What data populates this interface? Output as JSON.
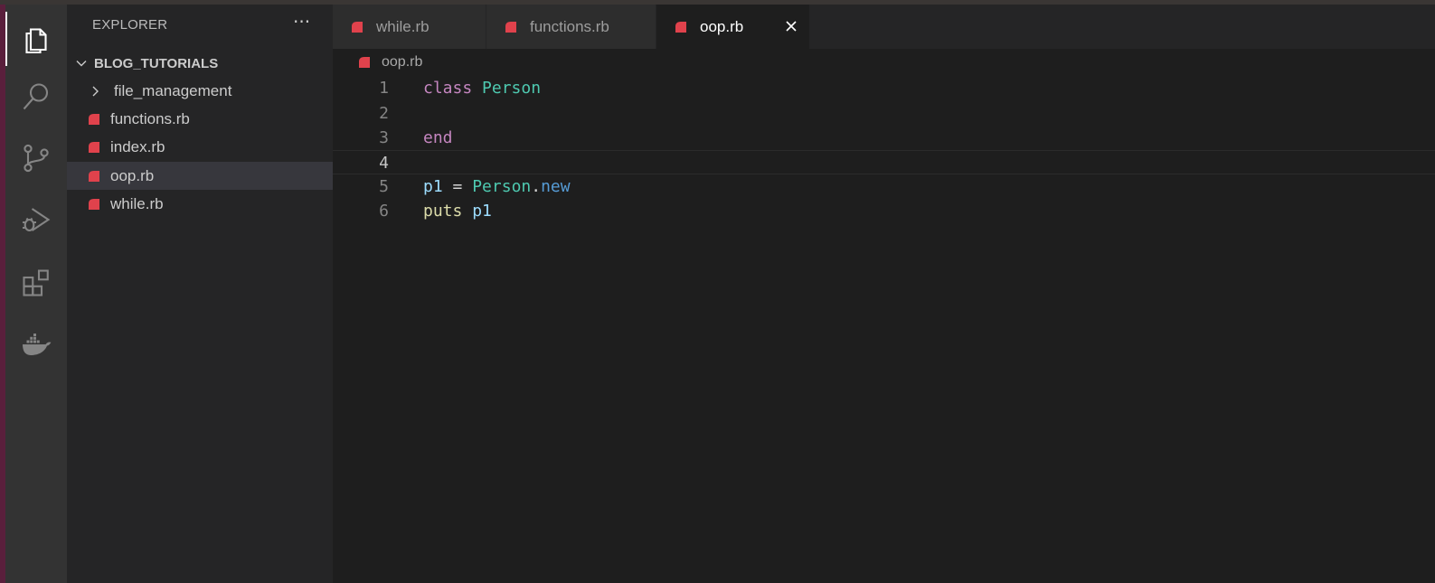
{
  "sidebar": {
    "title": "EXPLORER",
    "more": "···",
    "folder": "BLOG_TUTORIALS",
    "items": [
      {
        "label": "file_management",
        "type": "folder"
      },
      {
        "label": "functions.rb",
        "type": "file"
      },
      {
        "label": "index.rb",
        "type": "file"
      },
      {
        "label": "oop.rb",
        "type": "file",
        "selected": true
      },
      {
        "label": "while.rb",
        "type": "file"
      }
    ]
  },
  "tabs": [
    {
      "label": "while.rb",
      "active": false
    },
    {
      "label": "functions.rb",
      "active": false
    },
    {
      "label": "oop.rb",
      "active": true
    }
  ],
  "breadcrumb": "oop.rb",
  "editor": {
    "line_numbers": [
      "1",
      "2",
      "3",
      "4",
      "5",
      "6"
    ],
    "current_line": 4,
    "tokens": {
      "l1_kw": "class",
      "l1_cls": "Person",
      "l3_kw": "end",
      "l5_var": "p1",
      "l5_op": "=",
      "l5_cls": "Person",
      "l5_dot": ".",
      "l5_mth": "new",
      "l6_fn": "puts",
      "l6_var": "p1"
    }
  },
  "colors": {
    "ruby_icon": "#e0424c",
    "activity_bg": "#333333",
    "sidebar_bg": "#252526",
    "editor_bg": "#1e1e1e",
    "keyword": "#c586c0",
    "class": "#4ec9b0",
    "variable": "#9cdcfe",
    "function": "#dcdcaa",
    "method": "#569cd6"
  },
  "icons": {
    "activity": [
      "files-icon",
      "search-icon",
      "source-control-icon",
      "run-debug-icon",
      "extensions-icon",
      "docker-icon"
    ]
  }
}
